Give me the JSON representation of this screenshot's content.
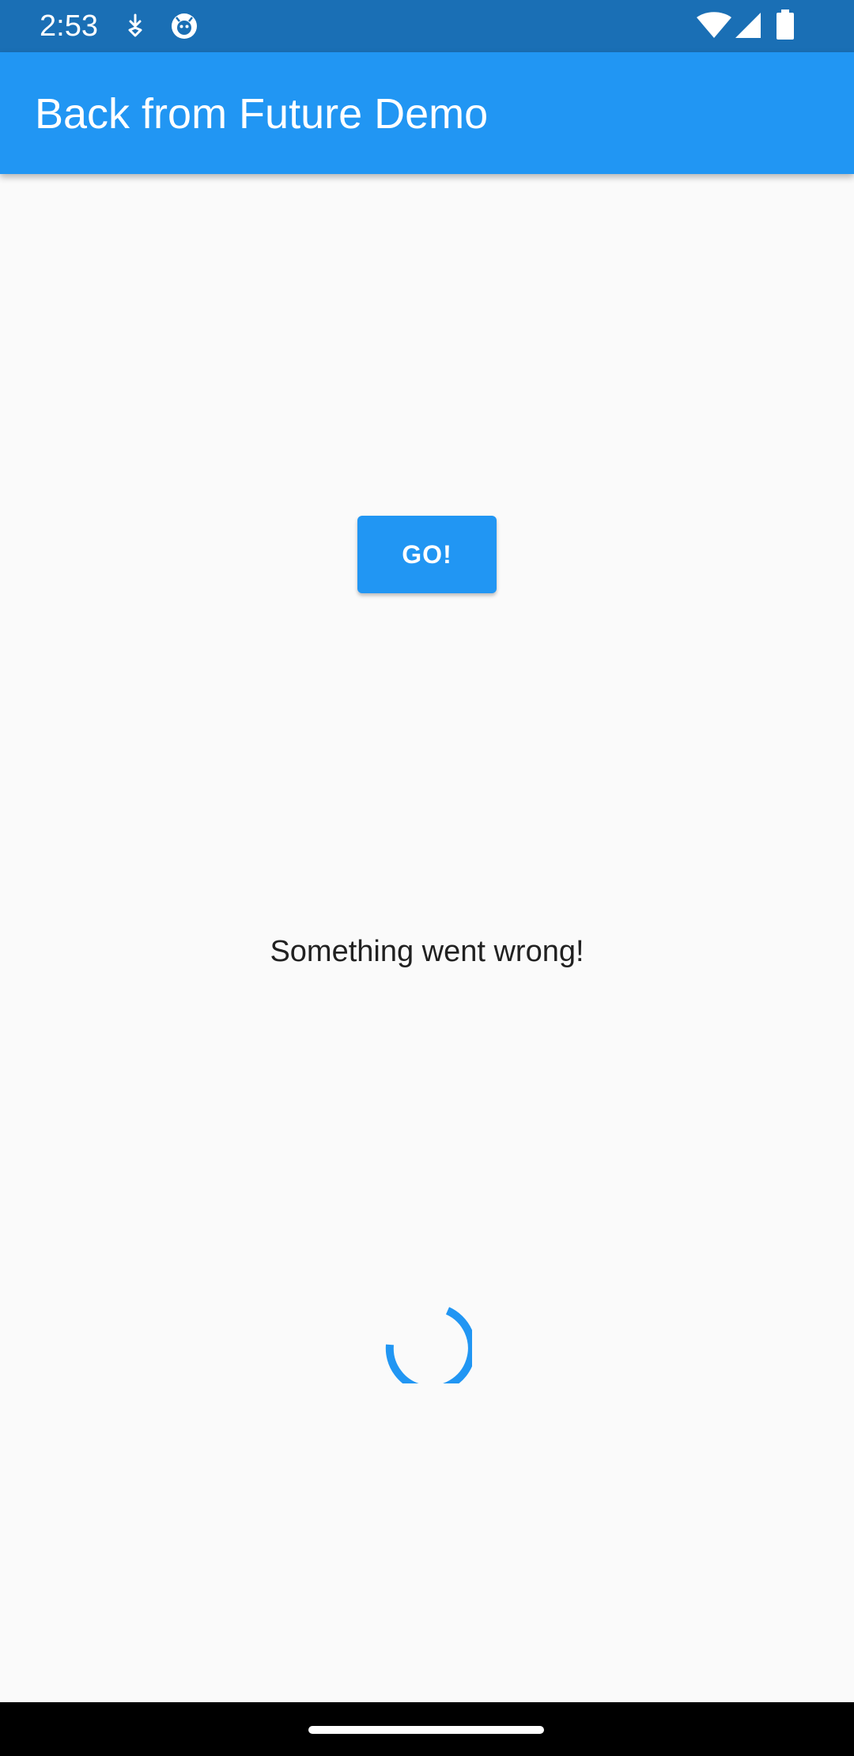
{
  "status_bar": {
    "time": "2:53",
    "left_icons": [
      "download-icon",
      "app-notification-icon"
    ],
    "right_icons": [
      "wifi-icon",
      "cell-signal-icon",
      "battery-icon"
    ]
  },
  "app_bar": {
    "title": "Back from Future Demo"
  },
  "main": {
    "go_button_label": "GO!",
    "message": "Something went wrong!",
    "spinner_icon": "progress-spinner-icon"
  },
  "colors": {
    "status_bar": "#1a6fb5",
    "primary": "#2196f3",
    "background": "#fafafa",
    "text": "#212121"
  }
}
